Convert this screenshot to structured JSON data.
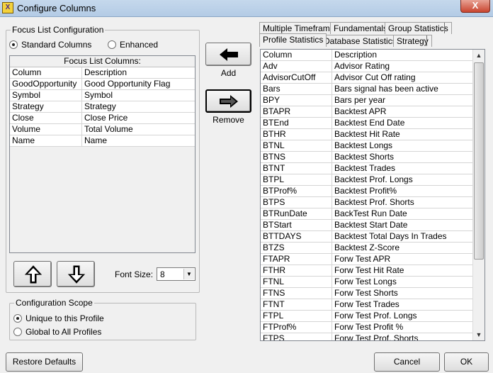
{
  "window": {
    "title": "Configure Columns",
    "close_glyph": "X",
    "app_icon_glyph": "X"
  },
  "focus_config": {
    "group_label": "Focus List Configuration",
    "standard_label": "Standard Columns",
    "enhanced_label": "Enhanced",
    "selected": "standard",
    "table_caption": "Focus List Columns:",
    "headers": [
      "Column",
      "Description"
    ],
    "rows": [
      [
        "GoodOpportunity",
        "Good Opportunity Flag"
      ],
      [
        "Symbol",
        "Symbol"
      ],
      [
        "Strategy",
        "Strategy"
      ],
      [
        "Close",
        "Close Price"
      ],
      [
        "Volume",
        "Total Volume"
      ],
      [
        "Name",
        "Name"
      ]
    ]
  },
  "font_size": {
    "label": "Font Size:",
    "value": "8"
  },
  "config_scope": {
    "group_label": "Configuration Scope",
    "unique_label": "Unique to this Profile",
    "global_label": "Global to All Profiles",
    "selected": "unique"
  },
  "actions": {
    "add_label": "Add",
    "remove_label": "Remove"
  },
  "tabs": {
    "row1": [
      "Multiple Timeframe",
      "Fundamentals",
      "Group Statistics"
    ],
    "row2": [
      "Profile Statistics",
      "Database Statistics",
      "Strategy"
    ],
    "active": "Profile Statistics"
  },
  "profile_table": {
    "headers": [
      "Column",
      "Description"
    ],
    "rows": [
      [
        "Adv",
        "Advisor Rating"
      ],
      [
        "AdvisorCutOff",
        "Advisor Cut Off rating"
      ],
      [
        "Bars",
        "Bars signal has been active"
      ],
      [
        "BPY",
        "Bars per year"
      ],
      [
        "BTAPR",
        "Backtest APR"
      ],
      [
        "BTEnd",
        "Backtest End Date"
      ],
      [
        "BTHR",
        "Backtest Hit Rate"
      ],
      [
        "BTNL",
        "Backtest Longs"
      ],
      [
        "BTNS",
        "Backtest Shorts"
      ],
      [
        "BTNT",
        "Backtest Trades"
      ],
      [
        "BTPL",
        "Backtest Prof. Longs"
      ],
      [
        "BTProf%",
        "Backtest Profit%"
      ],
      [
        "BTPS",
        "Backtest Prof. Shorts"
      ],
      [
        "BTRunDate",
        "BackTest Run Date"
      ],
      [
        "BTStart",
        "Backtest Start Date"
      ],
      [
        "BTTDAYS",
        "Backtest Total Days In Trades"
      ],
      [
        "BTZS",
        "Backtest Z-Score"
      ],
      [
        "FTAPR",
        "Forw Test APR"
      ],
      [
        "FTHR",
        "Forw Test Hit Rate"
      ],
      [
        "FTNL",
        "Forw Test Longs"
      ],
      [
        "FTNS",
        "Forw Test Shorts"
      ],
      [
        "FTNT",
        "Forw Test Trades"
      ],
      [
        "FTPL",
        "Forw Test Prof. Longs"
      ],
      [
        "FTProf%",
        "Forw Test Profit %"
      ],
      [
        "FTPS",
        "Forw Test Prof. Shorts"
      ]
    ]
  },
  "footer": {
    "restore_label": "Restore Defaults",
    "cancel_label": "Cancel",
    "ok_label": "OK"
  }
}
